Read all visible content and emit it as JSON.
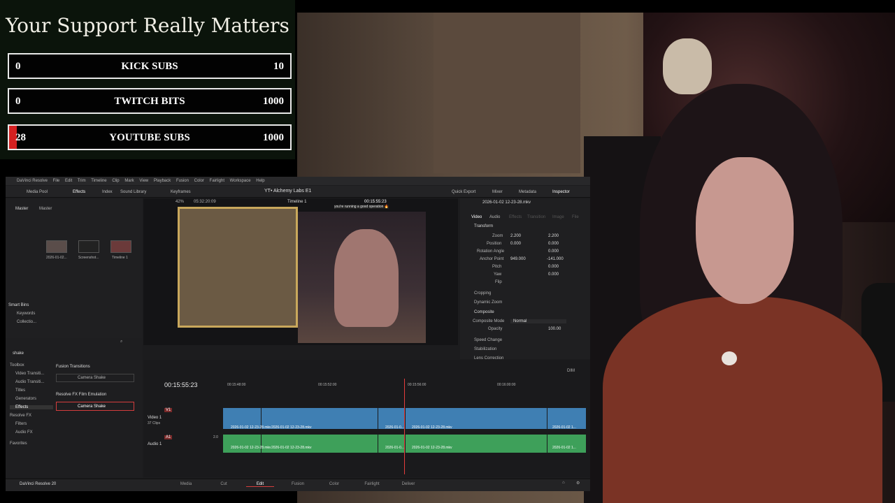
{
  "overlay": {
    "title": "Your Support Really Matters",
    "goals": [
      {
        "label": "KICK SUBS",
        "current": "0",
        "target": "10",
        "progress": 0
      },
      {
        "label": "TWITCH BITS",
        "current": "0",
        "target": "1000",
        "progress": 0
      },
      {
        "label": "YOUTUBE SUBS",
        "current": "28",
        "target": "1000",
        "progress": 0.028
      }
    ]
  },
  "resolve": {
    "app_name": "DaVinci Resolve",
    "menu": [
      "File",
      "Edit",
      "Trim",
      "Timeline",
      "Clip",
      "Mark",
      "View",
      "Playback",
      "Fusion",
      "Color",
      "Fairlight",
      "Workspace",
      "Help"
    ],
    "project_title": "YT• Alchemy Labs E1",
    "toolbar": {
      "media_pool": "Media Pool",
      "effects": "Effects",
      "index": "Index",
      "sound_library": "Sound Library",
      "keyframes": "Keyframes",
      "quick_export": "Quick Export",
      "mixer": "Mixer",
      "metadata": "Metadata",
      "inspector": "Inspector"
    },
    "media_pool": {
      "bins": [
        "Master",
        "Master"
      ],
      "clips": [
        "2026-01-02...",
        "Screenshot...",
        "Timeline 1"
      ],
      "smart_bins": "Smart Bins",
      "smart_items": [
        "Keywords",
        "Collectio..."
      ]
    },
    "effects": {
      "search": "shake",
      "tree": [
        "Toolbox",
        "Video Transiti...",
        "Audio Transiti...",
        "Titles",
        "Generators",
        "Effects",
        "Resolve FX",
        "Filters",
        "Audio FX",
        "Favorites"
      ],
      "groups": [
        {
          "name": "Fusion Transitions",
          "item": "Camera Shake"
        },
        {
          "name": "Resolve FX Film Emulation",
          "item": "Camera Shake"
        }
      ]
    },
    "viewer": {
      "zoom": "42%",
      "source_tc": "05:32:20:09",
      "timeline_name": "Timeline 1",
      "timecode": "00:15:55:23",
      "caption": "you're running a good operation 🔥"
    },
    "inspector": {
      "clip": "2026-01-02 12-23-28.mkv",
      "tabs": [
        "Video",
        "Audio",
        "Effects",
        "Transition",
        "Image",
        "File"
      ],
      "transform": {
        "title": "Transform",
        "zoom_label": "Zoom",
        "zoom_x": "2.200",
        "zoom_y": "2.200",
        "position_label": "Position",
        "position_x": "0.000",
        "position_y": "0.000",
        "rotation_label": "Rotation Angle",
        "rotation": "0.000",
        "anchor_label": "Anchor Point",
        "anchor_x": "949.000",
        "anchor_y": "-141.000",
        "pitch_label": "Pitch",
        "pitch": "0.000",
        "yaw_label": "Yaw",
        "yaw": "0.000",
        "flip_label": "Flip"
      },
      "sections": [
        "Cropping",
        "Dynamic Zoom",
        "Composite",
        "Speed Change",
        "Stabilization",
        "Lens Correction"
      ],
      "composite": {
        "mode_label": "Composite Mode",
        "mode": "Normal",
        "opacity_label": "Opacity",
        "opacity": "100.00"
      }
    },
    "timeline": {
      "timecode": "00:15:55:23",
      "ruler": [
        "00:15:48:00",
        "00:15:52:00",
        "00:15:56:00",
        "00:16:00:00"
      ],
      "v1_name": "Video 1",
      "v1_count": "37 Clips",
      "v1": "V1",
      "a1_name": "Audio 1",
      "a1": "A1",
      "a1_level": "2.0",
      "clip_names": [
        "2026-01-02 12-23-28.mkv",
        "2026-01-0...",
        "2026-01-02 12-23-28.mkv",
        "2026-01-02 12-23-28.mkv",
        "2026-01-02 12-23-28.mkv",
        "2026-01-0...",
        "2026-01-02 12-23-28.mkv",
        "2026-01-02 1..."
      ],
      "dim": "DIM"
    },
    "pages": [
      "Media",
      "Cut",
      "Edit",
      "Fusion",
      "Color",
      "Fairlight",
      "Deliver"
    ],
    "brand": "DaVinci Resolve 20"
  },
  "colors": {
    "accent": "#d42020",
    "resolve_bg": "#1c1c1e",
    "video_track": "#3f7fb3",
    "audio_track": "#3ea05a",
    "playhead": "#e53c3c"
  }
}
